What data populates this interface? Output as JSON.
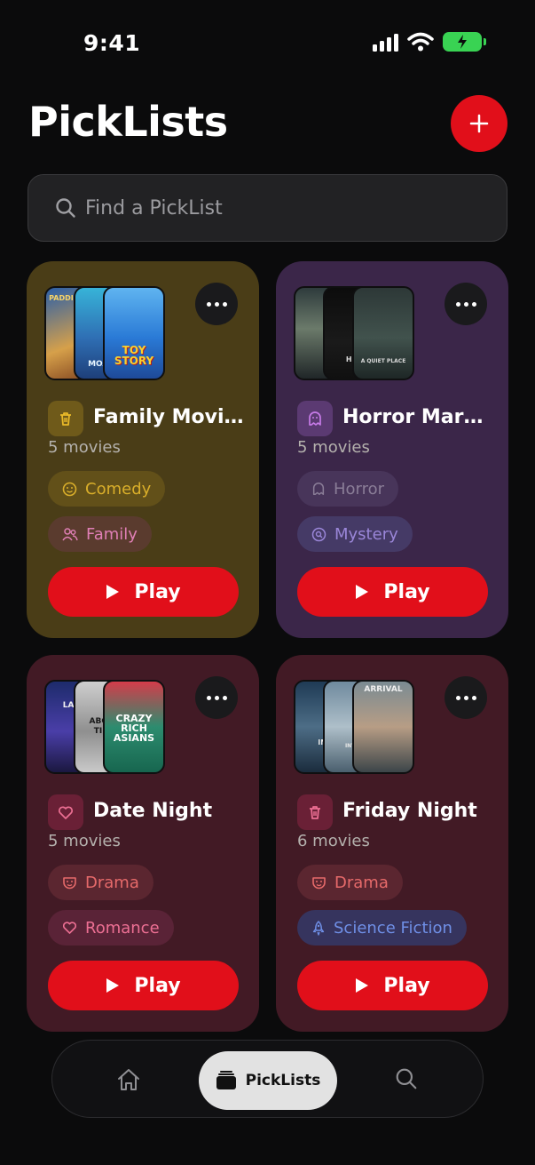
{
  "status_bar": {
    "time": "9:41"
  },
  "header": {
    "title": "PickLists",
    "add_button_icon": "plus-icon"
  },
  "search": {
    "placeholder": "Find a PickList",
    "value": ""
  },
  "picklists": [
    {
      "title": "Family Movie...",
      "count": "5 movies",
      "icon": "trash-icon",
      "posters": [
        "PADDINGTON",
        "MOANA",
        "TOY STORY"
      ],
      "tags": [
        {
          "label": "Comedy",
          "icon": "smile-icon"
        },
        {
          "label": "Family",
          "icon": "users-icon"
        }
      ],
      "play_label": "Play"
    },
    {
      "title": "Horror Marat...",
      "count": "5 movies",
      "icon": "ghost-icon",
      "posters": [
        "",
        "HER",
        "A QUIET PLACE"
      ],
      "tags": [
        {
          "label": "Horror",
          "icon": "ghost-icon"
        },
        {
          "label": "Mystery",
          "icon": "magnifier-icon"
        }
      ],
      "play_label": "Play"
    },
    {
      "title": "Date Night",
      "count": "5 movies",
      "icon": "heart-icon",
      "posters": [
        "LA LA",
        "ABOUT TIME",
        "CRAZY RICH ASIANS"
      ],
      "tags": [
        {
          "label": "Drama",
          "icon": "mask-icon"
        },
        {
          "label": "Romance",
          "icon": "heart-icon"
        }
      ],
      "play_label": "Play"
    },
    {
      "title": "Friday Night",
      "count": "6 movies",
      "icon": "trash-icon",
      "posters": [
        "INC",
        "INTER",
        "ARRIVAL"
      ],
      "tags": [
        {
          "label": "Drama",
          "icon": "mask-icon"
        },
        {
          "label": "Science Fiction",
          "icon": "rocket-icon"
        }
      ],
      "play_label": "Play"
    }
  ],
  "nav": {
    "home_icon": "home-icon",
    "picklists_label": "PickLists",
    "picklists_icon": "stack-icon",
    "search_icon": "search-icon"
  }
}
